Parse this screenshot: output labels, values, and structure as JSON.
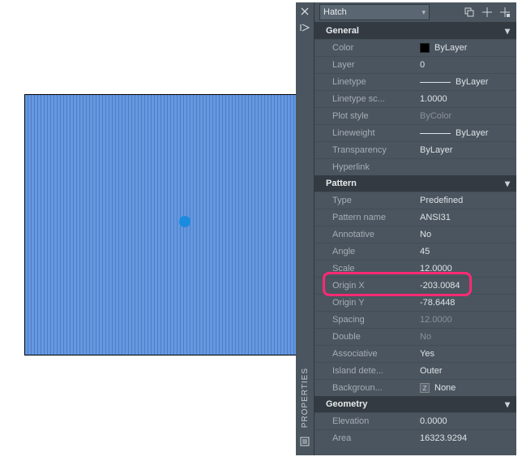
{
  "toolbar": {
    "object_type": "Hatch"
  },
  "sidebar": {
    "label": "PROPERTIES"
  },
  "sections": {
    "general": {
      "title": "General",
      "color": {
        "label": "Color",
        "value": "ByLayer"
      },
      "layer": {
        "label": "Layer",
        "value": "0"
      },
      "linetype": {
        "label": "Linetype",
        "value": "ByLayer"
      },
      "linetype_scale": {
        "label": "Linetype sc...",
        "value": "1.0000"
      },
      "plot_style": {
        "label": "Plot style",
        "value": "ByColor"
      },
      "lineweight": {
        "label": "Lineweight",
        "value": "ByLayer"
      },
      "transparency": {
        "label": "Transparency",
        "value": "ByLayer"
      },
      "hyperlink": {
        "label": "Hyperlink",
        "value": ""
      }
    },
    "pattern": {
      "title": "Pattern",
      "type": {
        "label": "Type",
        "value": "Predefined"
      },
      "pattern_name": {
        "label": "Pattern name",
        "value": "ANSI31"
      },
      "annotative": {
        "label": "Annotative",
        "value": "No"
      },
      "angle": {
        "label": "Angle",
        "value": "45"
      },
      "scale": {
        "label": "Scale",
        "value": "12.0000"
      },
      "origin_x": {
        "label": "Origin X",
        "value": "-203.0084"
      },
      "origin_y": {
        "label": "Origin Y",
        "value": "-78.6448"
      },
      "spacing": {
        "label": "Spacing",
        "value": "12.0000"
      },
      "double": {
        "label": "Double",
        "value": "No"
      },
      "associative": {
        "label": "Associative",
        "value": "Yes"
      },
      "island": {
        "label": "Island dete...",
        "value": "Outer"
      },
      "background": {
        "label": "Backgroun...",
        "value": "None"
      }
    },
    "geometry": {
      "title": "Geometry",
      "elevation": {
        "label": "Elevation",
        "value": "0.0000"
      },
      "area": {
        "label": "Area",
        "value": "16323.9294"
      }
    }
  }
}
